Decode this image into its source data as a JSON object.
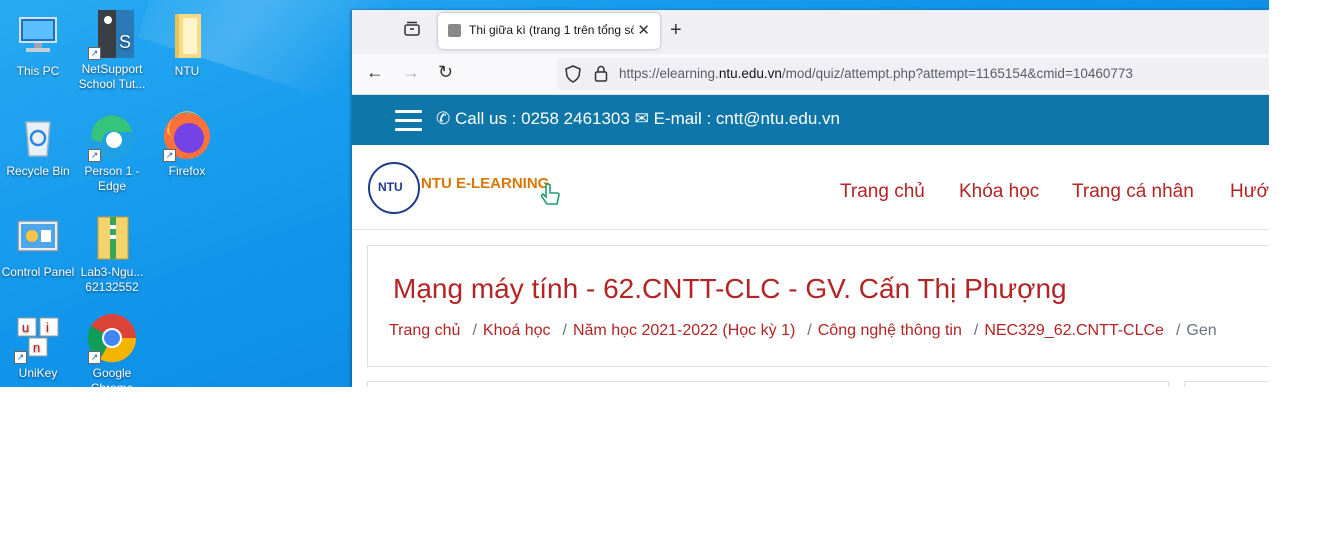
{
  "desktop": {
    "icons": [
      {
        "label": "This PC"
      },
      {
        "label": "NetSupport School Tut..."
      },
      {
        "label": "NTU"
      },
      {
        "label": "Recycle Bin"
      },
      {
        "label": "Person 1 - Edge"
      },
      {
        "label": "Firefox"
      },
      {
        "label": "Control Panel"
      },
      {
        "label": "Lab3-Ngu... 62132552"
      },
      {
        "label": "UniKey"
      },
      {
        "label": "Google Chrome"
      }
    ]
  },
  "browser": {
    "tab_title": "Thi giữa kì (trang 1 trên tổng số",
    "url_prefix": "https://elearning.",
    "url_domain": "ntu.edu.vn",
    "url_path": "/mod/quiz/attempt.php?attempt=1165154&cmid=10460773"
  },
  "site": {
    "contact_phone": "Call us : 0258 2461303",
    "contact_email": "E-mail : cntt@ntu.edu.vn",
    "logo_mark": "NTU",
    "brand": "NTU E-LEARNING",
    "nav": [
      "Trang chủ",
      "Khóa học",
      "Trang cá nhân",
      "Hướ"
    ],
    "course_title": "Mạng máy tính - 62.CNTT-CLC - GV. Cấn Thị Phượng",
    "breadcrumb": [
      "Trang chủ",
      "Khoá học",
      "Năm học 2021-2022 (Học kỳ 1)",
      "Công nghệ thông tin",
      "NEC329_62.CNTT-CLCe",
      "Gen"
    ]
  },
  "colors": {
    "desktop_bg": "#0f94ea",
    "topbar": "#0e76a8",
    "accent_red": "#b32424"
  }
}
